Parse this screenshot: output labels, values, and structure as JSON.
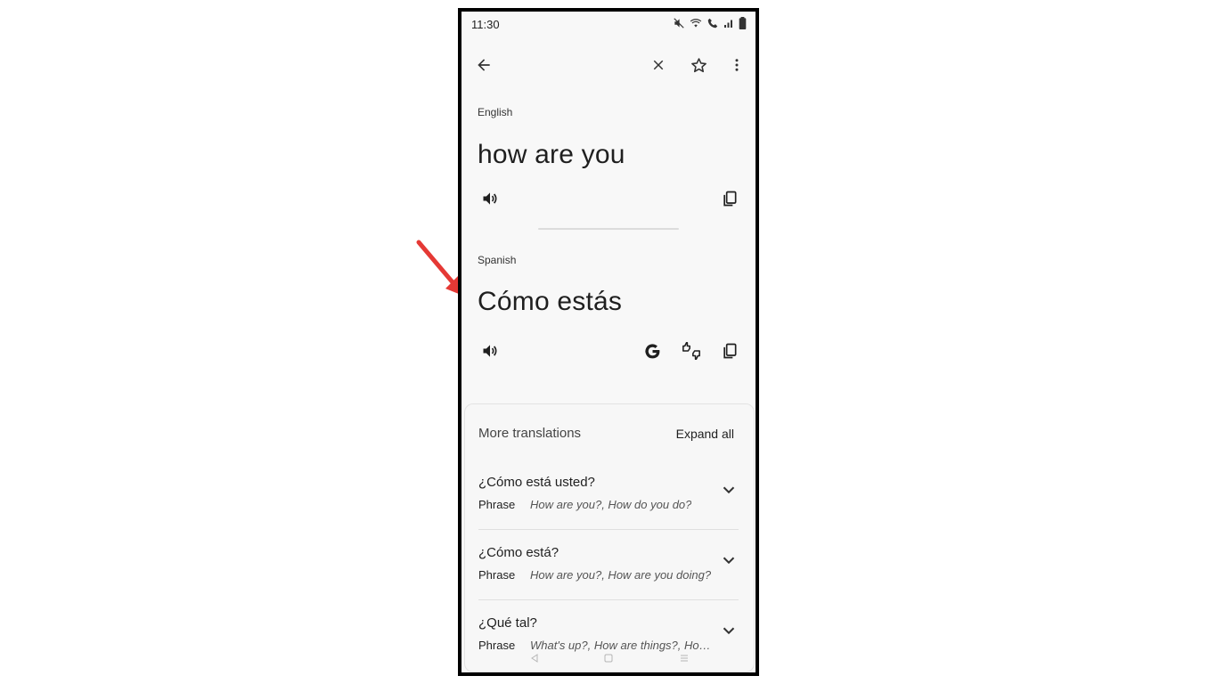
{
  "status": {
    "time": "11:30",
    "icons": [
      "mute-icon",
      "wifi-icon",
      "wifi-call-icon",
      "signal-icon",
      "battery-icon"
    ]
  },
  "toolbar": {
    "back_icon": "arrow-left-icon",
    "close_icon": "close-icon",
    "star_icon": "star-outline-icon",
    "more_icon": "more-vert-icon"
  },
  "source": {
    "language": "English",
    "text": "how are you"
  },
  "target": {
    "language": "Spanish",
    "text": "Cómo estás"
  },
  "more_translations": {
    "title": "More translations",
    "expand_label": "Expand all",
    "items": [
      {
        "phrase": "¿Cómo está usted?",
        "pos": "Phrase",
        "synonyms": "How are you?, How do you do?"
      },
      {
        "phrase": "¿Cómo está?",
        "pos": "Phrase",
        "synonyms": "How are you?, How are you doing?"
      },
      {
        "phrase": "¿Qué tal?",
        "pos": "Phrase",
        "synonyms": "What's up?, How are things?, How are you?"
      }
    ]
  },
  "colors": {
    "annotation_arrow": "#e53935",
    "screen_background": "#f8f8f8",
    "frame": "#000000"
  }
}
